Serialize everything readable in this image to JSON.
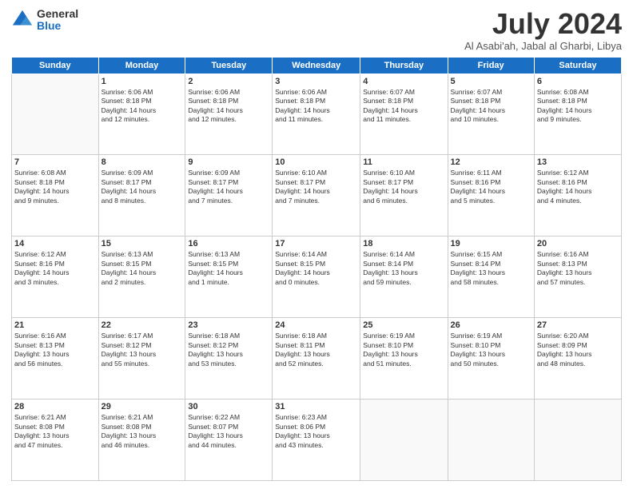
{
  "header": {
    "logo_general": "General",
    "logo_blue": "Blue",
    "month_title": "July 2024",
    "location": "Al Asabi'ah, Jabal al Gharbi, Libya"
  },
  "weekdays": [
    "Sunday",
    "Monday",
    "Tuesday",
    "Wednesday",
    "Thursday",
    "Friday",
    "Saturday"
  ],
  "weeks": [
    [
      {
        "day": "",
        "info": ""
      },
      {
        "day": "1",
        "info": "Sunrise: 6:06 AM\nSunset: 8:18 PM\nDaylight: 14 hours\nand 12 minutes."
      },
      {
        "day": "2",
        "info": "Sunrise: 6:06 AM\nSunset: 8:18 PM\nDaylight: 14 hours\nand 12 minutes."
      },
      {
        "day": "3",
        "info": "Sunrise: 6:06 AM\nSunset: 8:18 PM\nDaylight: 14 hours\nand 11 minutes."
      },
      {
        "day": "4",
        "info": "Sunrise: 6:07 AM\nSunset: 8:18 PM\nDaylight: 14 hours\nand 11 minutes."
      },
      {
        "day": "5",
        "info": "Sunrise: 6:07 AM\nSunset: 8:18 PM\nDaylight: 14 hours\nand 10 minutes."
      },
      {
        "day": "6",
        "info": "Sunrise: 6:08 AM\nSunset: 8:18 PM\nDaylight: 14 hours\nand 9 minutes."
      }
    ],
    [
      {
        "day": "7",
        "info": "Sunrise: 6:08 AM\nSunset: 8:18 PM\nDaylight: 14 hours\nand 9 minutes."
      },
      {
        "day": "8",
        "info": "Sunrise: 6:09 AM\nSunset: 8:17 PM\nDaylight: 14 hours\nand 8 minutes."
      },
      {
        "day": "9",
        "info": "Sunrise: 6:09 AM\nSunset: 8:17 PM\nDaylight: 14 hours\nand 7 minutes."
      },
      {
        "day": "10",
        "info": "Sunrise: 6:10 AM\nSunset: 8:17 PM\nDaylight: 14 hours\nand 7 minutes."
      },
      {
        "day": "11",
        "info": "Sunrise: 6:10 AM\nSunset: 8:17 PM\nDaylight: 14 hours\nand 6 minutes."
      },
      {
        "day": "12",
        "info": "Sunrise: 6:11 AM\nSunset: 8:16 PM\nDaylight: 14 hours\nand 5 minutes."
      },
      {
        "day": "13",
        "info": "Sunrise: 6:12 AM\nSunset: 8:16 PM\nDaylight: 14 hours\nand 4 minutes."
      }
    ],
    [
      {
        "day": "14",
        "info": "Sunrise: 6:12 AM\nSunset: 8:16 PM\nDaylight: 14 hours\nand 3 minutes."
      },
      {
        "day": "15",
        "info": "Sunrise: 6:13 AM\nSunset: 8:15 PM\nDaylight: 14 hours\nand 2 minutes."
      },
      {
        "day": "16",
        "info": "Sunrise: 6:13 AM\nSunset: 8:15 PM\nDaylight: 14 hours\nand 1 minute."
      },
      {
        "day": "17",
        "info": "Sunrise: 6:14 AM\nSunset: 8:15 PM\nDaylight: 14 hours\nand 0 minutes."
      },
      {
        "day": "18",
        "info": "Sunrise: 6:14 AM\nSunset: 8:14 PM\nDaylight: 13 hours\nand 59 minutes."
      },
      {
        "day": "19",
        "info": "Sunrise: 6:15 AM\nSunset: 8:14 PM\nDaylight: 13 hours\nand 58 minutes."
      },
      {
        "day": "20",
        "info": "Sunrise: 6:16 AM\nSunset: 8:13 PM\nDaylight: 13 hours\nand 57 minutes."
      }
    ],
    [
      {
        "day": "21",
        "info": "Sunrise: 6:16 AM\nSunset: 8:13 PM\nDaylight: 13 hours\nand 56 minutes."
      },
      {
        "day": "22",
        "info": "Sunrise: 6:17 AM\nSunset: 8:12 PM\nDaylight: 13 hours\nand 55 minutes."
      },
      {
        "day": "23",
        "info": "Sunrise: 6:18 AM\nSunset: 8:12 PM\nDaylight: 13 hours\nand 53 minutes."
      },
      {
        "day": "24",
        "info": "Sunrise: 6:18 AM\nSunset: 8:11 PM\nDaylight: 13 hours\nand 52 minutes."
      },
      {
        "day": "25",
        "info": "Sunrise: 6:19 AM\nSunset: 8:10 PM\nDaylight: 13 hours\nand 51 minutes."
      },
      {
        "day": "26",
        "info": "Sunrise: 6:19 AM\nSunset: 8:10 PM\nDaylight: 13 hours\nand 50 minutes."
      },
      {
        "day": "27",
        "info": "Sunrise: 6:20 AM\nSunset: 8:09 PM\nDaylight: 13 hours\nand 48 minutes."
      }
    ],
    [
      {
        "day": "28",
        "info": "Sunrise: 6:21 AM\nSunset: 8:08 PM\nDaylight: 13 hours\nand 47 minutes."
      },
      {
        "day": "29",
        "info": "Sunrise: 6:21 AM\nSunset: 8:08 PM\nDaylight: 13 hours\nand 46 minutes."
      },
      {
        "day": "30",
        "info": "Sunrise: 6:22 AM\nSunset: 8:07 PM\nDaylight: 13 hours\nand 44 minutes."
      },
      {
        "day": "31",
        "info": "Sunrise: 6:23 AM\nSunset: 8:06 PM\nDaylight: 13 hours\nand 43 minutes."
      },
      {
        "day": "",
        "info": ""
      },
      {
        "day": "",
        "info": ""
      },
      {
        "day": "",
        "info": ""
      }
    ]
  ]
}
